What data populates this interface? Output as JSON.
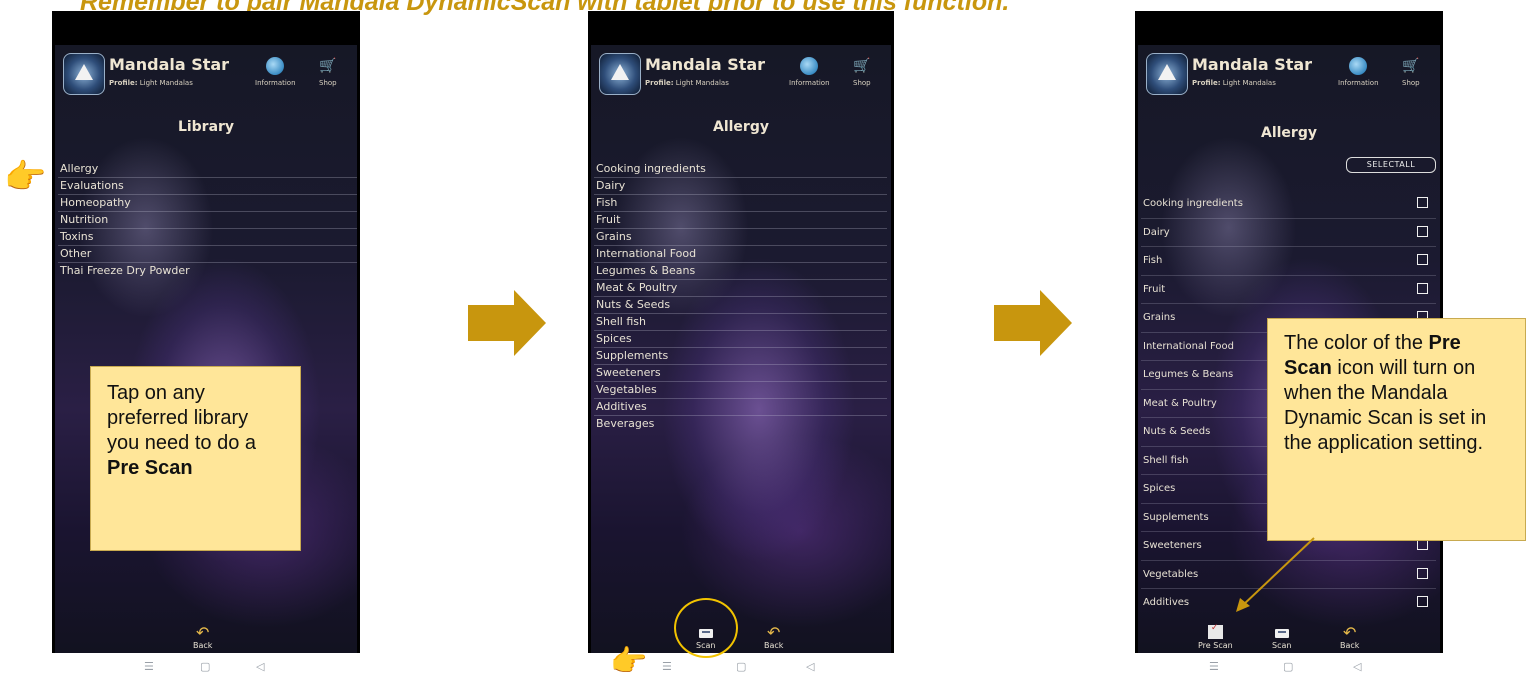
{
  "banner": "Remember to pair Mandala DynamicScan with tablet prior to use this function.",
  "app": {
    "title": "Mandala Star",
    "profile_label": "Profile:",
    "profile_value": "Light Mandalas",
    "information": "Information",
    "shop": "Shop"
  },
  "screen1": {
    "title": "Library",
    "items": [
      "Allergy",
      "Evaluations",
      "Homeopathy",
      "Nutrition",
      "Toxins",
      "Other",
      "Thai Freeze Dry Powder"
    ],
    "back": "Back"
  },
  "screen2": {
    "title": "Allergy",
    "items": [
      "Cooking ingredients",
      "Dairy",
      "Fish",
      "Fruit",
      "Grains",
      "International Food",
      "Legumes & Beans",
      "Meat & Poultry",
      "Nuts & Seeds",
      "Shell fish",
      "Spices",
      "Supplements",
      "Sweeteners",
      "Vegetables",
      "Additives",
      "Beverages"
    ],
    "scan": "Scan",
    "back": "Back"
  },
  "screen3": {
    "title": "Allergy",
    "select_all": "SELECTALL",
    "items": [
      "Cooking ingredients",
      "Dairy",
      "Fish",
      "Fruit",
      "Grains",
      "International Food",
      "Legumes & Beans",
      "Meat & Poultry",
      "Nuts & Seeds",
      "Shell fish",
      "Spices",
      "Supplements",
      "Sweeteners",
      "Vegetables",
      "Additives"
    ],
    "pre_scan": "Pre Scan",
    "scan": "Scan",
    "back": "Back"
  },
  "nav": {
    "menu": "☰",
    "home": "▢",
    "back": "◁"
  },
  "callout1": {
    "text_before": "Tap on any preferred library you need to do a",
    "bold": "Pre Scan"
  },
  "callout2": {
    "text_before": "The color of the",
    "bold": "Pre Scan",
    "text_after": "icon will turn on when the Mandala Dynamic Scan is set in the application setting."
  },
  "colors": {
    "accent": "#c8960e",
    "callout_bg": "#ffe699",
    "circle": "#f2c300"
  }
}
